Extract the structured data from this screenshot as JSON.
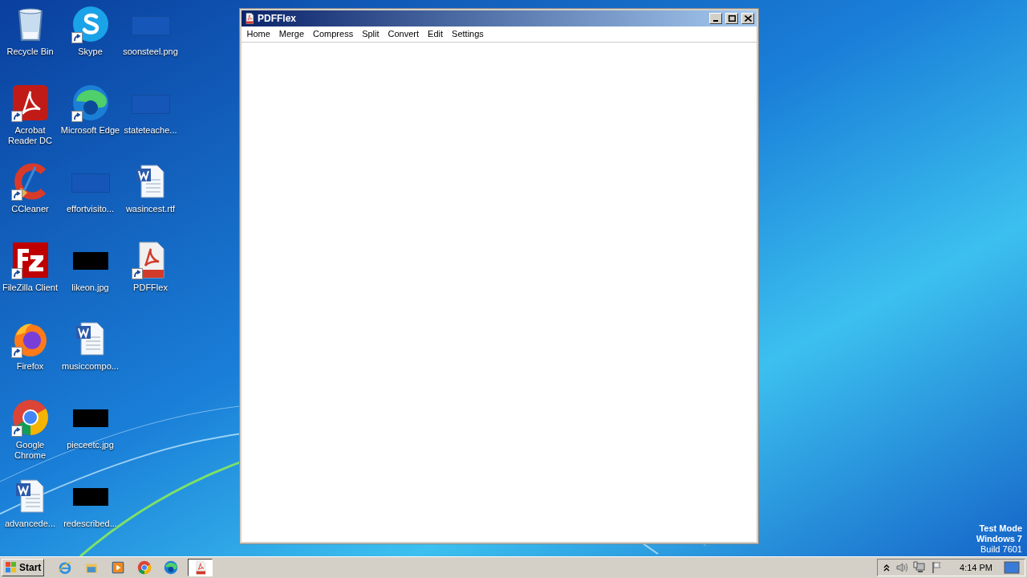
{
  "desktop_icons": [
    {
      "label": "Recycle Bin",
      "kind": "recycle",
      "shortcut": false
    },
    {
      "label": "Acrobat Reader DC",
      "kind": "acrobat",
      "shortcut": true
    },
    {
      "label": "CCleaner",
      "kind": "ccleaner",
      "shortcut": true
    },
    {
      "label": "FileZilla Client",
      "kind": "filezilla",
      "shortcut": true
    },
    {
      "label": "Firefox",
      "kind": "firefox",
      "shortcut": true
    },
    {
      "label": "Google Chrome",
      "kind": "chrome",
      "shortcut": true
    },
    {
      "label": "advancede...",
      "kind": "word",
      "shortcut": false
    },
    {
      "label": "Skype",
      "kind": "skype",
      "shortcut": true
    },
    {
      "label": "Microsoft Edge",
      "kind": "edge",
      "shortcut": true
    },
    {
      "label": "effortvisito...",
      "kind": "blank",
      "shortcut": false
    },
    {
      "label": "likeon.jpg",
      "kind": "black",
      "shortcut": false
    },
    {
      "label": "musiccompo...",
      "kind": "word",
      "shortcut": false
    },
    {
      "label": "pieceetc.jpg",
      "kind": "black",
      "shortcut": false
    },
    {
      "label": "redescribed...",
      "kind": "black",
      "shortcut": false
    },
    {
      "label": "soonsteel.png",
      "kind": "blank",
      "shortcut": false
    },
    {
      "label": "stateteache...",
      "kind": "blank",
      "shortcut": false
    },
    {
      "label": "wasincest.rtf",
      "kind": "word",
      "shortcut": false
    },
    {
      "label": "PDFFlex",
      "kind": "pdf",
      "shortcut": true
    }
  ],
  "window": {
    "title": "PDFFlex",
    "menu": [
      "Home",
      "Merge",
      "Compress",
      "Split",
      "Convert",
      "Edit",
      "Settings"
    ]
  },
  "taskbar": {
    "start": "Start",
    "quick_launch": [
      {
        "kind": "ie"
      },
      {
        "kind": "explorer"
      },
      {
        "kind": "media"
      },
      {
        "kind": "chrome"
      },
      {
        "kind": "edge"
      }
    ],
    "tasks": [
      {
        "kind": "pdf",
        "selected": true
      }
    ],
    "clock": "4:14 PM"
  },
  "system_notice": [
    "Test Mode",
    "Windows 7",
    "Build 7601"
  ]
}
